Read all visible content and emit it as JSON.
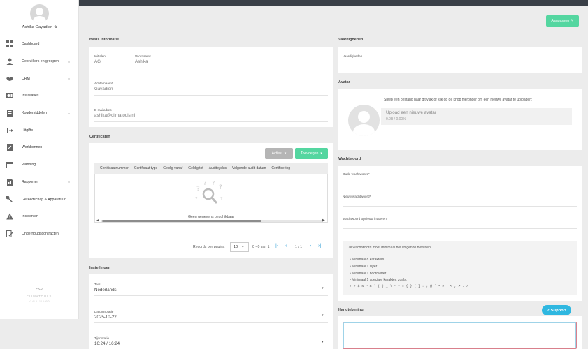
{
  "user": {
    "name": "Ashika Gayadien"
  },
  "sidebar": {
    "items": [
      {
        "label": "Dashboard",
        "icon": "dashboard-icon"
      },
      {
        "label": "Gebruikers en groepen",
        "icon": "user-icon",
        "expandable": true
      },
      {
        "label": "CRM",
        "icon": "handshake-icon",
        "expandable": true
      },
      {
        "label": "Installaties",
        "icon": "installation-icon"
      },
      {
        "label": "Koudemiddelen",
        "icon": "refrigerant-icon",
        "expandable": true
      },
      {
        "label": "Uitgifte",
        "icon": "export-icon"
      },
      {
        "label": "Werkbonnen",
        "icon": "workorder-icon"
      },
      {
        "label": "Planning",
        "icon": "calendar-icon"
      },
      {
        "label": "Rapporten",
        "icon": "report-icon",
        "expandable": true
      },
      {
        "label": "Gereedschap & Apparatuur",
        "icon": "wrench-icon"
      },
      {
        "label": "Incidenten",
        "icon": "warning-icon"
      },
      {
        "label": "Onderhoudscontracten",
        "icon": "contract-icon"
      }
    ]
  },
  "logo": {
    "word": "CLIMATOOLS",
    "version": "v2.41.0 - 14.0.00.0"
  },
  "header": {
    "edit_button": "Aanpassen"
  },
  "basis": {
    "title": "Basis informatie",
    "initialen_label": "Initialen",
    "initialen_value": "AG",
    "voornaam_label": "Voornaam*",
    "voornaam_value": "Ashika",
    "achternaam_label": "Achternaam*",
    "achternaam_value": "Gayadien",
    "email_label": "E-mailadres",
    "email_value": "ashika@climatools.nl"
  },
  "certificaten": {
    "title": "Certificaten",
    "acties_button": "Acties",
    "toevoegen_button": "Toevoegen",
    "columns": [
      "Certificaatnummer",
      "Certificaat type",
      "Geldig vanaf",
      "Geldig tot",
      "Auditcyclus",
      "Volgende audit datum",
      "Certificering"
    ],
    "empty_text": "Geen gegevens beschikbaar",
    "records_label": "Records per pagina",
    "records_value": "10",
    "range_text": "0 - 0 van 1",
    "page_text": "1 / 1"
  },
  "instellingen": {
    "title": "Instellingen",
    "taal_label": "Taal",
    "taal_value": "Nederlands",
    "datum_label": "Datumnotatie",
    "datum_value": "2025-10-22",
    "tijd_label": "Tijdnotatie",
    "tijd_value": "16:24 / 16:24"
  },
  "vaardigheden": {
    "title": "Vaardigheden",
    "field_label": "Vaardigheden"
  },
  "avatar": {
    "title": "Avatar",
    "instruction": "Sleep een bestand naar dit vlak of klik op de knop hieronder om een nieuwe avatar te uploaden:",
    "upload_title": "Upload een nieuwe avatar",
    "upload_progress": "0.0B / 0.00%"
  },
  "wachtwoord": {
    "title": "Wachtwoord",
    "oude_label": "Oude wachtwoord*",
    "nieuw_label": "Nieuw wachtwoord*",
    "herhaal_label": "Wachtwoord opnieuw invoeren*",
    "requirements_intro": "Je wachtwoord moet minimaal het volgende bevatten:",
    "requirements": [
      "Minimaal 8 karakters",
      "Minimaal 1 cijfer",
      "Minimaal 1 hoofdletter",
      "Minimaal 1 speciale karakter, zoals:"
    ],
    "special_chars": "! ? $ % ^ & * ( ) _ \\ - + = { } [ ] : ; @ ' ~ # | < , > . /"
  },
  "handtekening": {
    "title": "Handtekening"
  },
  "support": {
    "label": "Support"
  },
  "colors": {
    "accent": "#54d6a0",
    "topbar": "#3a3f47",
    "support": "#2fb7e0",
    "link": "#3aa3d8"
  }
}
